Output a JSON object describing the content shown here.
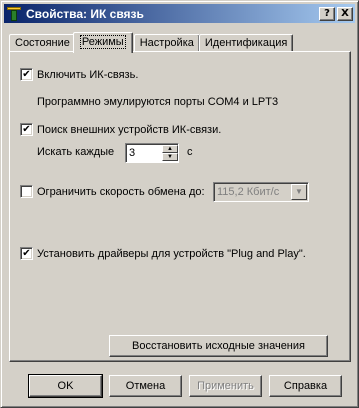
{
  "window": {
    "title": "Свойства: ИК связь"
  },
  "titlebar_buttons": {
    "help": "?",
    "close": "X"
  },
  "tabs": [
    {
      "label": "Состояние",
      "active": false
    },
    {
      "label": "Режимы",
      "active": true
    },
    {
      "label": "Настройка",
      "active": false
    },
    {
      "label": "Идентификация",
      "active": false
    }
  ],
  "enable_ir": {
    "checked": true,
    "label": "Включить ИК-связь."
  },
  "emulated_ports_text": "Программно эмулируются порты COM4 и LPT3",
  "search_devices": {
    "checked": true,
    "label": "Поиск внешних устройств ИК-связи."
  },
  "search_interval": {
    "label": "Искать каждые",
    "value": "3",
    "unit": "с"
  },
  "limit_speed": {
    "checked": false,
    "label": "Ограничить скорость обмена до:",
    "value": "115,2 Кбит/с"
  },
  "plug_and_play": {
    "checked": true,
    "label": "Установить драйверы для устройств \"Plug and Play\"."
  },
  "restore_defaults_label": "Восстановить исходные значения",
  "footer": {
    "ok": "OK",
    "cancel": "Отмена",
    "apply": "Применить",
    "help": "Справка"
  }
}
